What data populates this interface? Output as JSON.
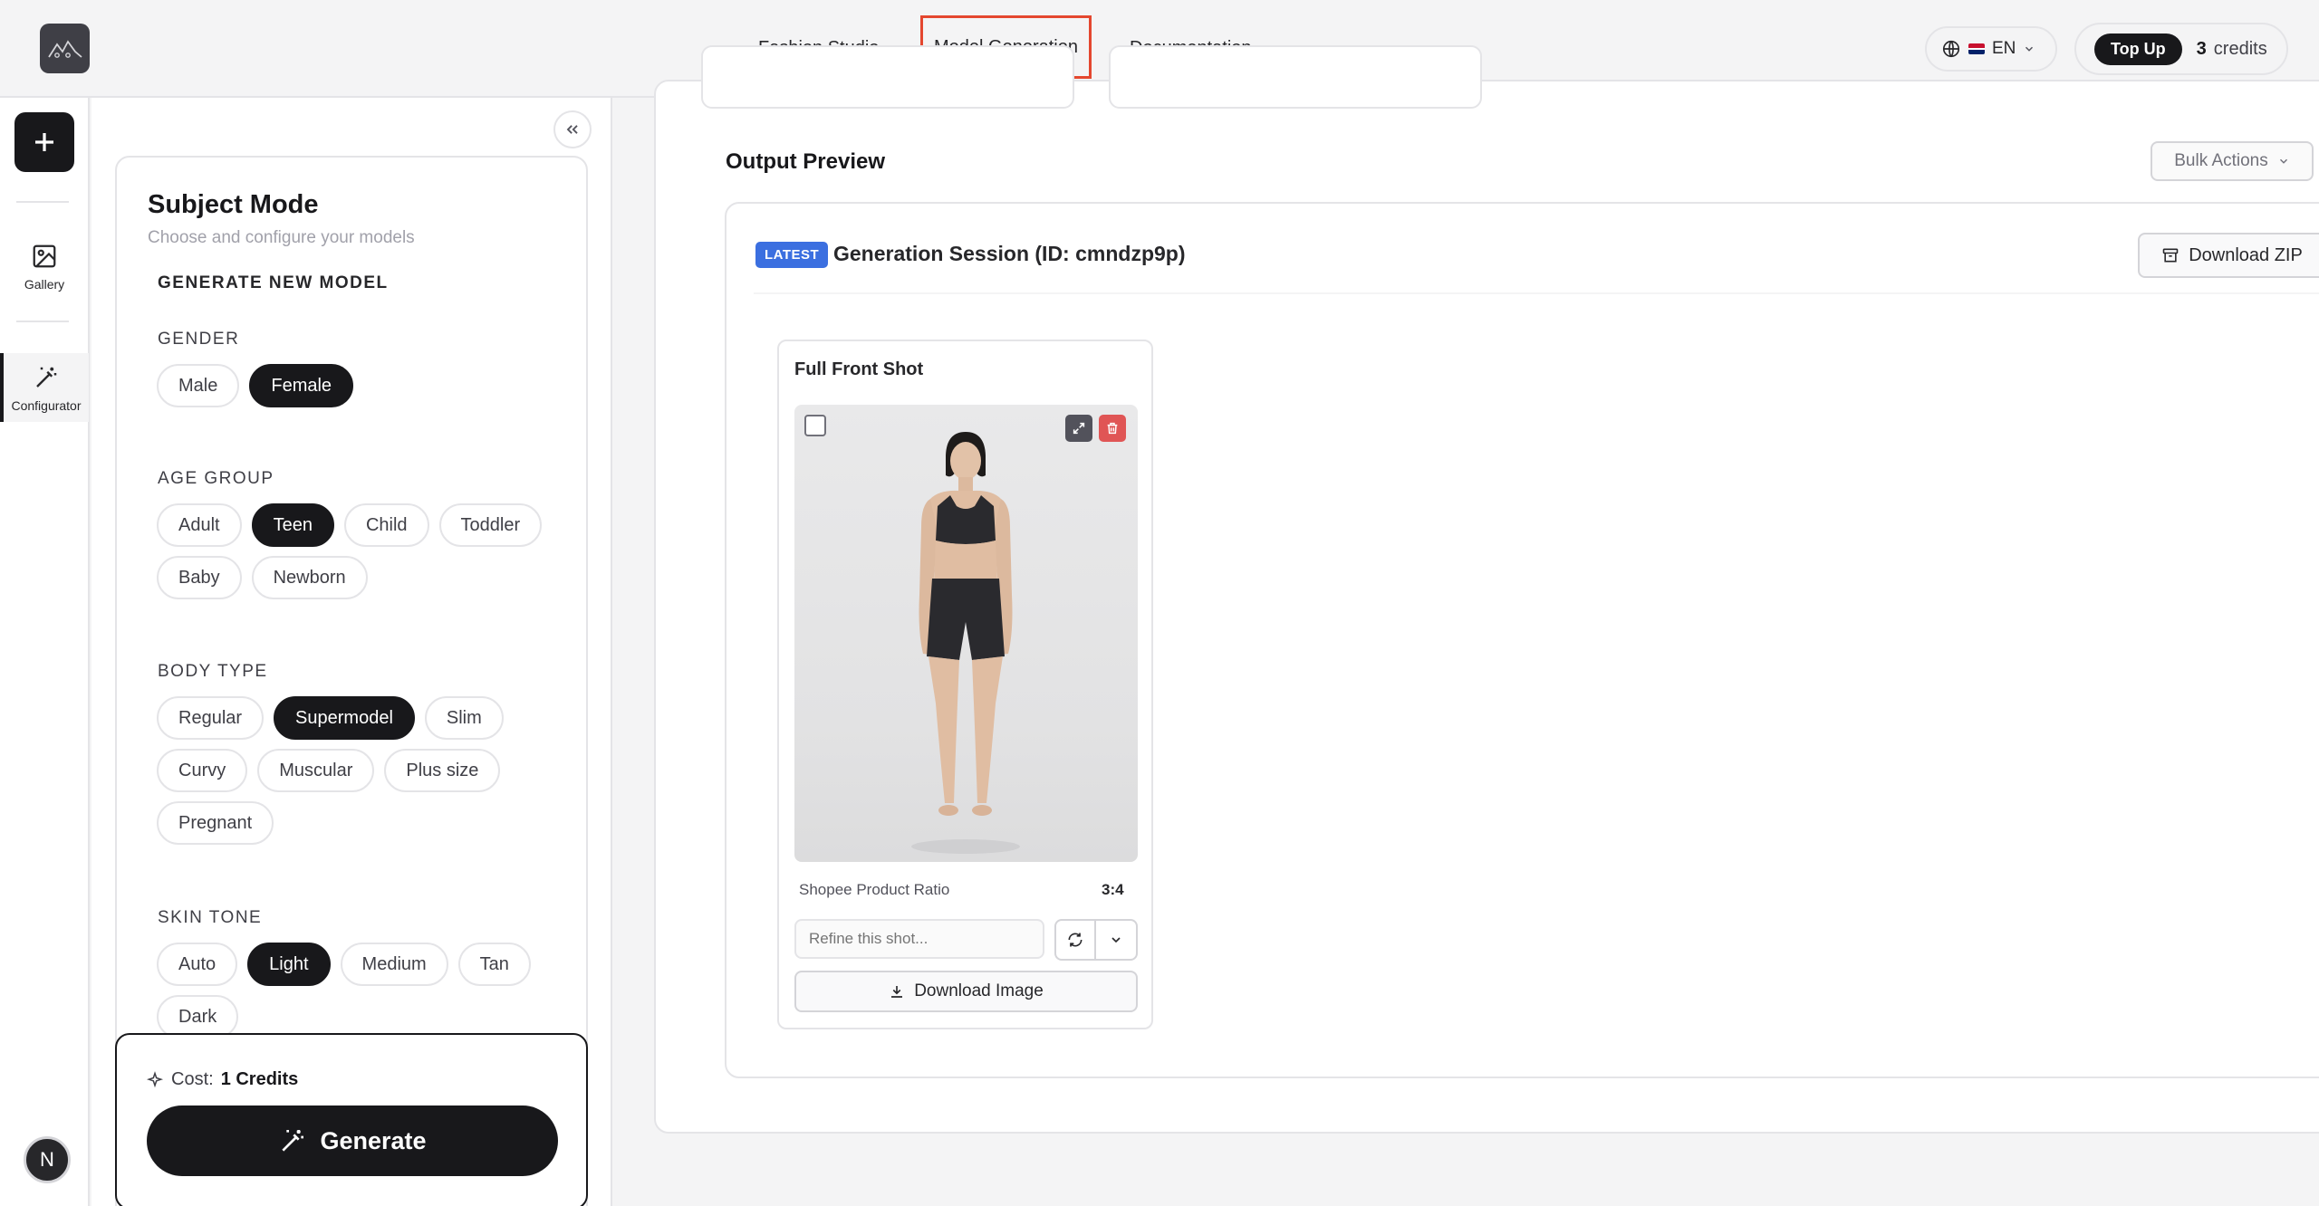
{
  "topbar": {
    "nav": [
      "Fashion Studio",
      "Model Generation",
      "Documentation"
    ],
    "active_nav": "Model Generation",
    "language": "EN",
    "topup_label": "Top Up",
    "credits_count": "3",
    "credits_label": "credits"
  },
  "rail": {
    "gallery_label": "Gallery",
    "configurator_label": "Configurator",
    "avatar_initial": "N"
  },
  "config": {
    "title": "Subject Mode",
    "subtitle": "Choose and configure your models",
    "generate_heading": "GENERATE NEW MODEL",
    "gender": {
      "label": "GENDER",
      "options": [
        "Male",
        "Female"
      ],
      "selected": "Female"
    },
    "age_group": {
      "label": "AGE GROUP",
      "options": [
        "Adult",
        "Teen",
        "Child",
        "Toddler",
        "Baby",
        "Newborn"
      ],
      "selected": "Teen"
    },
    "body_type": {
      "label": "BODY TYPE",
      "options": [
        "Regular",
        "Supermodel",
        "Slim",
        "Curvy",
        "Muscular",
        "Plus size",
        "Pregnant"
      ],
      "selected": "Supermodel"
    },
    "skin_tone": {
      "label": "SKIN TONE",
      "options": [
        "Auto",
        "Light",
        "Medium",
        "Tan",
        "Dark"
      ],
      "selected": "Light"
    },
    "cost_label": "Cost:",
    "cost_value": "1 Credits",
    "generate_label": "Generate"
  },
  "main": {
    "output_title": "Output Preview",
    "bulk_actions_label": "Bulk Actions",
    "session": {
      "badge": "LATEST",
      "title": "Generation Session (ID: cmndzp9p)",
      "download_zip_label": "Download ZIP",
      "shot": {
        "title": "Full Front Shot",
        "ratio_label": "Shopee Product Ratio",
        "ratio_value": "3:4",
        "refine_placeholder": "Refine this shot...",
        "download_label": "Download Image"
      }
    }
  },
  "colors": {
    "accent_dark": "#18181b",
    "latest_badge": "#3b6fe0",
    "delete_red": "#e05555",
    "highlight_border": "#e4472f"
  }
}
